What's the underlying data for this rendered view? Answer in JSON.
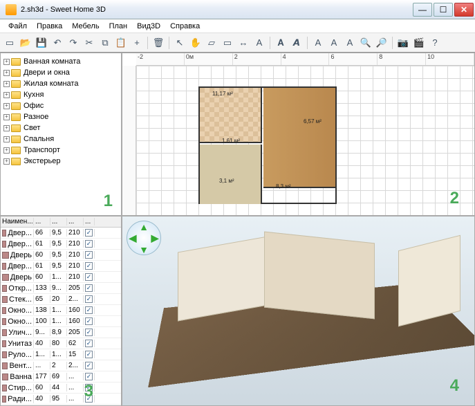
{
  "window": {
    "title": "2.sh3d - Sweet Home 3D",
    "buttons": {
      "min": "—",
      "max": "☐",
      "close": "✕"
    }
  },
  "menu": [
    "Файл",
    "Правка",
    "Мебель",
    "План",
    "Вид3D",
    "Справка"
  ],
  "toolbar_icons": [
    "new",
    "open",
    "save",
    "undo",
    "redo",
    "cut",
    "copy",
    "paste",
    "add",
    "sep",
    "delete",
    "sep",
    "select",
    "pan",
    "wall",
    "room",
    "dim",
    "text",
    "sep",
    "bold",
    "italic",
    "sep",
    "t1",
    "t2",
    "t3",
    "zoom-in",
    "zoom-out",
    "sep",
    "photo",
    "video",
    "help"
  ],
  "catalog": [
    "Ванная комната",
    "Двери и окна",
    "Жилая комната",
    "Кухня",
    "Офис",
    "Разное",
    "Свет",
    "Спальня",
    "Транспорт",
    "Экстерьер"
  ],
  "ruler_h": [
    "-2",
    "0м",
    "2",
    "4",
    "6",
    "8",
    "10"
  ],
  "plan": {
    "labels": {
      "kitchen": "11,17 м²",
      "small": "1,61 м²",
      "living": "8,3 м²",
      "bath": "3,1 м²",
      "living2": "6,57 м²"
    }
  },
  "furniture": {
    "headers": [
      "Наимен...",
      "...",
      "...",
      "...",
      "..."
    ],
    "rows": [
      {
        "name": "Двер...",
        "w": "66",
        "d": "9,5",
        "h": "210",
        "v": true
      },
      {
        "name": "Двер...",
        "w": "61",
        "d": "9,5",
        "h": "210",
        "v": true
      },
      {
        "name": "Дверь",
        "w": "60",
        "d": "9,5",
        "h": "210",
        "v": true
      },
      {
        "name": "Двер...",
        "w": "61",
        "d": "9,5",
        "h": "210",
        "v": true
      },
      {
        "name": "Дверь",
        "w": "60",
        "d": "1...",
        "h": "210",
        "v": true
      },
      {
        "name": "Откр...",
        "w": "133",
        "d": "9...",
        "h": "205",
        "v": true
      },
      {
        "name": "Стек...",
        "w": "65",
        "d": "20",
        "h": "2...",
        "v": true
      },
      {
        "name": "Окно...",
        "w": "138",
        "d": "1...",
        "h": "160",
        "v": true
      },
      {
        "name": "Окно...",
        "w": "100",
        "d": "1...",
        "h": "160",
        "v": true
      },
      {
        "name": "Улич...",
        "w": "9...",
        "d": "8,9",
        "h": "205",
        "v": true
      },
      {
        "name": "Унитаз",
        "w": "40",
        "d": "80",
        "h": "62",
        "v": true
      },
      {
        "name": "Руло...",
        "w": "1...",
        "d": "1...",
        "h": "15",
        "v": true
      },
      {
        "name": "Вент...",
        "w": "...",
        "d": "2",
        "h": "2...",
        "v": true
      },
      {
        "name": "Ванна",
        "w": "177",
        "d": "69",
        "h": "...",
        "v": true
      },
      {
        "name": "Стир...",
        "w": "60",
        "d": "44",
        "h": "...",
        "v": true
      },
      {
        "name": "Ради...",
        "w": "40",
        "d": "95",
        "h": "...",
        "v": true
      }
    ]
  },
  "panel_numbers": {
    "catalog": "1",
    "plan": "2",
    "furniture": "3",
    "view3d": "4"
  }
}
